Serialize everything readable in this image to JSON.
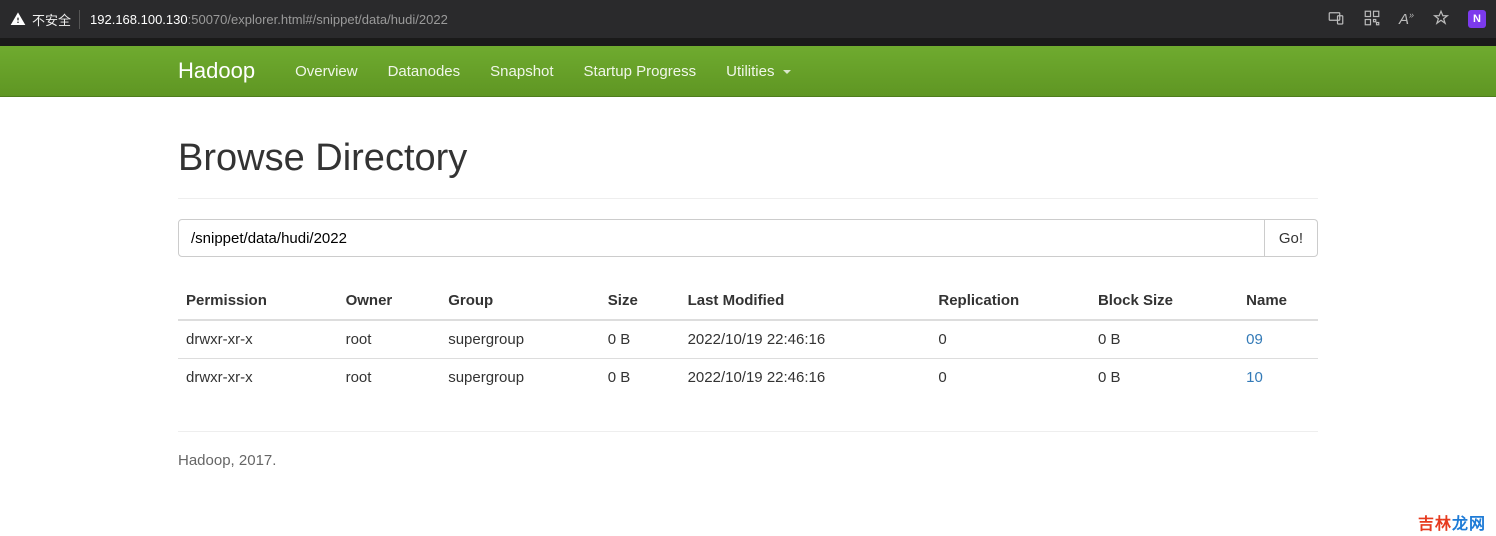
{
  "browser": {
    "insecure_label": "不安全",
    "url_host": "192.168.100.130",
    "url_rest": ":50070/explorer.html#/snippet/data/hudi/2022",
    "badge": "N"
  },
  "nav": {
    "brand": "Hadoop",
    "items": [
      "Overview",
      "Datanodes",
      "Snapshot",
      "Startup Progress",
      "Utilities"
    ]
  },
  "page": {
    "title": "Browse Directory",
    "path_value": "/snippet/data/hudi/2022",
    "go_label": "Go!",
    "footer": "Hadoop, 2017."
  },
  "table": {
    "headers": {
      "permission": "Permission",
      "owner": "Owner",
      "group": "Group",
      "size": "Size",
      "last_modified": "Last Modified",
      "replication": "Replication",
      "block_size": "Block Size",
      "name": "Name"
    },
    "rows": [
      {
        "permission": "drwxr-xr-x",
        "owner": "root",
        "group": "supergroup",
        "size": "0 B",
        "last_modified": "2022/10/19 22:46:16",
        "replication": "0",
        "block_size": "0 B",
        "name": "09"
      },
      {
        "permission": "drwxr-xr-x",
        "owner": "root",
        "group": "supergroup",
        "size": "0 B",
        "last_modified": "2022/10/19 22:46:16",
        "replication": "0",
        "block_size": "0 B",
        "name": "10"
      }
    ]
  },
  "watermark": {
    "a": "吉林",
    "b": "龙网"
  }
}
